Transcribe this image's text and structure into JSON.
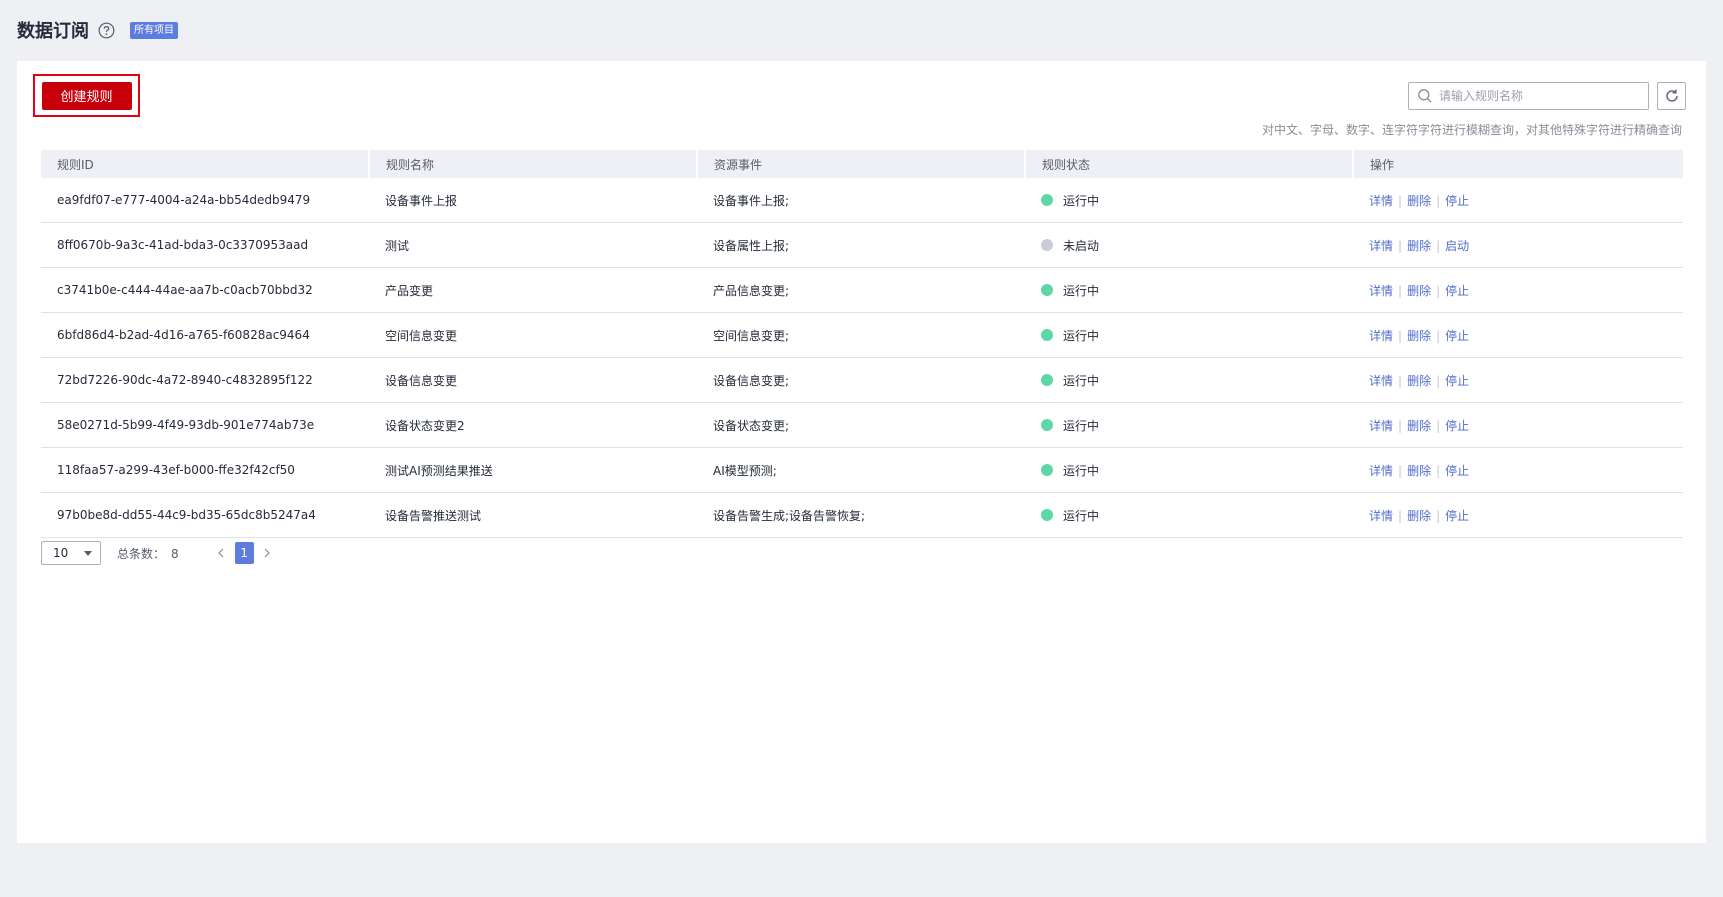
{
  "header": {
    "title": "数据订阅",
    "badge": "所有项目"
  },
  "toolbar": {
    "create_label": "创建规则",
    "search_placeholder": "请输入规则名称",
    "search_hint": "对中文、字母、数字、连字符字符进行模糊查询，对其他特殊字符进行精确查询"
  },
  "colors": {
    "accent": "#c7000b",
    "link": "#526ecc",
    "status_running": "#5ed7a6",
    "status_stopped": "#c8ccd6",
    "page_active": "#5e7ce0"
  },
  "table": {
    "columns": [
      "规则ID",
      "规则名称",
      "资源事件",
      "规则状态",
      "操作"
    ],
    "rows": [
      {
        "id": "ea9fdf07-e777-4004-a24a-bb54dedb9479",
        "name": "设备事件上报",
        "event": "设备事件上报;",
        "status": "运行中",
        "status_color": "#5ed7a6",
        "ops": [
          "详情",
          "删除",
          "停止"
        ]
      },
      {
        "id": "8ff0670b-9a3c-41ad-bda3-0c3370953aad",
        "name": "测试",
        "event": "设备属性上报;",
        "status": "未启动",
        "status_color": "#c8ccd6",
        "ops": [
          "详情",
          "删除",
          "启动"
        ]
      },
      {
        "id": "c3741b0e-c444-44ae-aa7b-c0acb70bbd32",
        "name": "产品变更",
        "event": "产品信息变更;",
        "status": "运行中",
        "status_color": "#5ed7a6",
        "ops": [
          "详情",
          "删除",
          "停止"
        ]
      },
      {
        "id": "6bfd86d4-b2ad-4d16-a765-f60828ac9464",
        "name": "空间信息变更",
        "event": "空间信息变更;",
        "status": "运行中",
        "status_color": "#5ed7a6",
        "ops": [
          "详情",
          "删除",
          "停止"
        ]
      },
      {
        "id": "72bd7226-90dc-4a72-8940-c4832895f122",
        "name": "设备信息变更",
        "event": "设备信息变更;",
        "status": "运行中",
        "status_color": "#5ed7a6",
        "ops": [
          "详情",
          "删除",
          "停止"
        ]
      },
      {
        "id": "58e0271d-5b99-4f49-93db-901e774ab73e",
        "name": "设备状态变更2",
        "event": "设备状态变更;",
        "status": "运行中",
        "status_color": "#5ed7a6",
        "ops": [
          "详情",
          "删除",
          "停止"
        ]
      },
      {
        "id": "118faa57-a299-43ef-b000-ffe32f42cf50",
        "name": "测试AI预测结果推送",
        "event": "AI模型预测;",
        "status": "运行中",
        "status_color": "#5ed7a6",
        "ops": [
          "详情",
          "删除",
          "停止"
        ]
      },
      {
        "id": "97b0be8d-dd55-44c9-bd35-65dc8b5247a4",
        "name": "设备告警推送测试",
        "event": "设备告警生成;设备告警恢复;",
        "status": "运行中",
        "status_color": "#5ed7a6",
        "ops": [
          "详情",
          "删除",
          "停止"
        ]
      }
    ]
  },
  "pagination": {
    "page_size": "10",
    "total_label": "总条数：",
    "total": "8",
    "current_page": "1"
  }
}
